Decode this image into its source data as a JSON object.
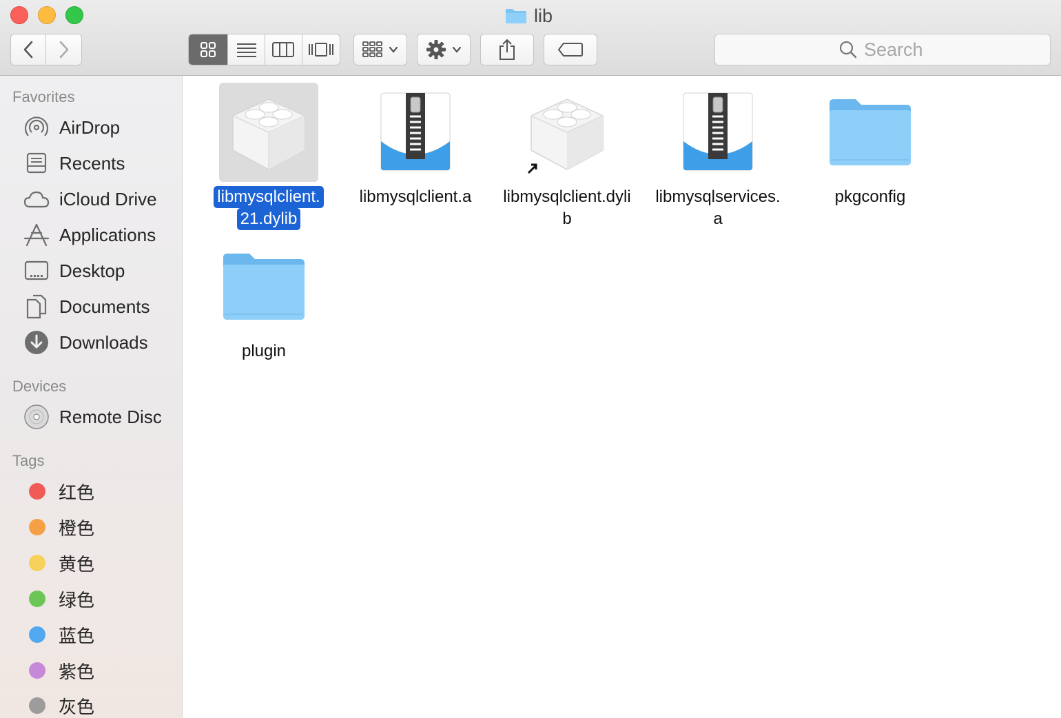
{
  "window": {
    "title": "lib"
  },
  "toolbar": {
    "search_placeholder": "Search"
  },
  "sidebar": {
    "favorites_header": "Favorites",
    "favorites": [
      {
        "label": "AirDrop",
        "icon": "airdrop-icon"
      },
      {
        "label": "Recents",
        "icon": "recents-icon"
      },
      {
        "label": "iCloud Drive",
        "icon": "cloud-icon"
      },
      {
        "label": "Applications",
        "icon": "applications-icon"
      },
      {
        "label": "Desktop",
        "icon": "desktop-icon"
      },
      {
        "label": "Documents",
        "icon": "documents-icon"
      },
      {
        "label": "Downloads",
        "icon": "downloads-icon"
      }
    ],
    "devices_header": "Devices",
    "devices": [
      {
        "label": "Remote Disc",
        "icon": "disc-icon"
      }
    ],
    "tags_header": "Tags",
    "tags": [
      {
        "label": "红色",
        "color": "#f05b55"
      },
      {
        "label": "橙色",
        "color": "#f5a044"
      },
      {
        "label": "黄色",
        "color": "#f6d25a"
      },
      {
        "label": "绿色",
        "color": "#6cc655"
      },
      {
        "label": "蓝色",
        "color": "#52a8f0"
      },
      {
        "label": "紫色",
        "color": "#c689d9"
      },
      {
        "label": "灰色",
        "color": "#9c9c9c"
      }
    ]
  },
  "files": [
    {
      "name_line1": "libmysqlclient.",
      "name_line2": "21.dylib",
      "type": "dylib",
      "selected": true
    },
    {
      "name_line1": "libmysqlclient.a",
      "name_line2": "",
      "type": "archive",
      "selected": false
    },
    {
      "name_line1": "libmysqlclient.dyli",
      "name_line2": "b",
      "type": "dylib-alias",
      "selected": false
    },
    {
      "name_line1": "libmysqlservices.",
      "name_line2": "a",
      "type": "archive",
      "selected": false
    },
    {
      "name_line1": "pkgconfig",
      "name_line2": "",
      "type": "folder",
      "selected": false
    },
    {
      "name_line1": "plugin",
      "name_line2": "",
      "type": "folder",
      "selected": false
    }
  ],
  "colors": {
    "selection": "#1c64d6",
    "folder": "#7cc4f4"
  }
}
